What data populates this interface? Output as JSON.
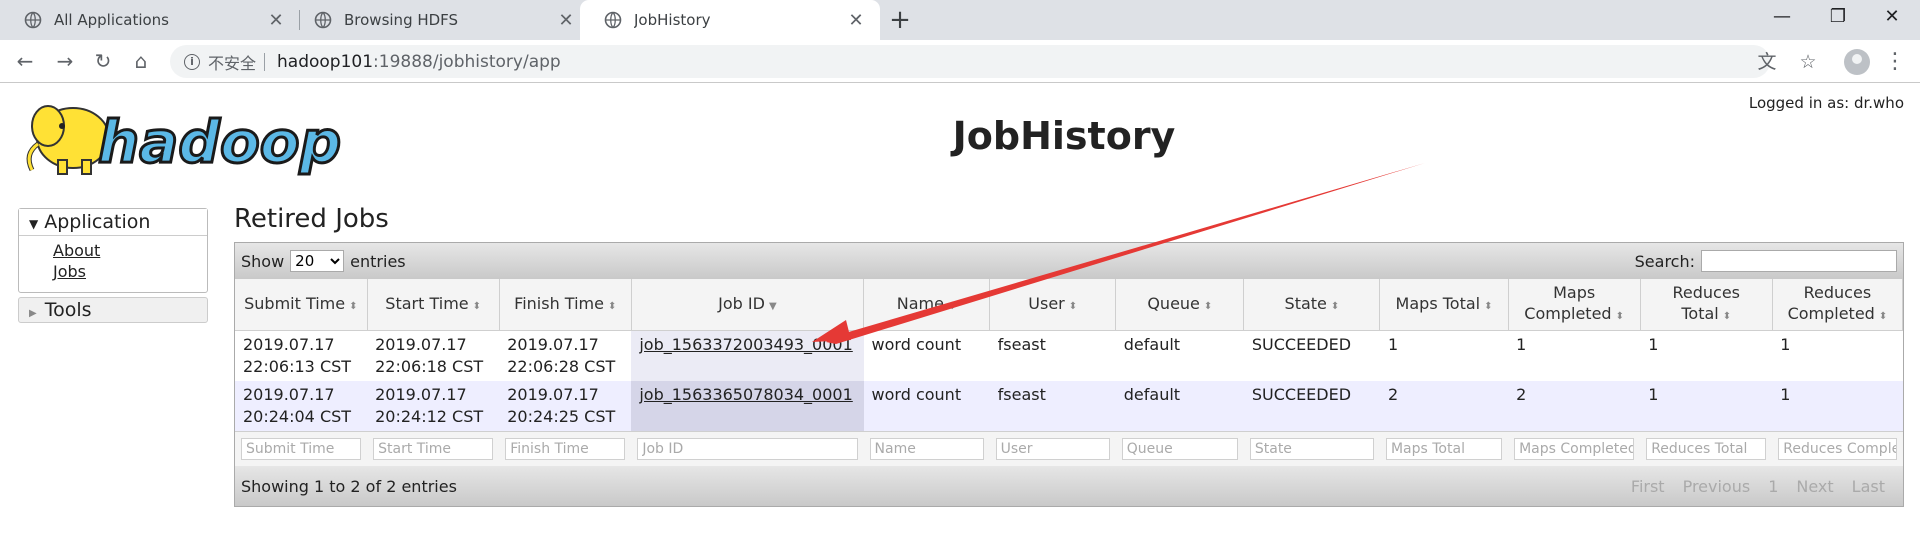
{
  "browser": {
    "tabs": [
      {
        "title": "All Applications",
        "active": false
      },
      {
        "title": "Browsing HDFS",
        "active": false
      },
      {
        "title": "JobHistory",
        "active": true
      }
    ],
    "insecure_label": "不安全",
    "url_host": "hadoop101",
    "url_rest": ":19888/jobhistory/app"
  },
  "page": {
    "logo_text": "hadoop",
    "logged_in": "Logged in as: dr.who",
    "title": "JobHistory"
  },
  "nav": {
    "application_label": "Application",
    "links": [
      "About",
      "Jobs"
    ],
    "tools_label": "Tools"
  },
  "jobs": {
    "section_title": "Retired Jobs",
    "show_label": "Show",
    "page_size": "20",
    "entries_label": "entries",
    "search_label": "Search:",
    "columns": [
      "Submit Time",
      "Start Time",
      "Finish Time",
      "Job ID",
      "Name",
      "User",
      "Queue",
      "State",
      "Maps Total",
      "Maps Completed",
      "Reduces Total",
      "Reduces Completed"
    ],
    "rows": [
      {
        "submit": "2019.07.17 22:06:13 CST",
        "start": "2019.07.17 22:06:18 CST",
        "finish": "2019.07.17 22:06:28 CST",
        "job_id": "job_1563372003493_0001",
        "name": "word count",
        "user": "fseast",
        "queue": "default",
        "state": "SUCCEEDED",
        "maps_total": "1",
        "maps_completed": "1",
        "reduces_total": "1",
        "reduces_completed": "1"
      },
      {
        "submit": "2019.07.17 20:24:04 CST",
        "start": "2019.07.17 20:24:12 CST",
        "finish": "2019.07.17 20:24:25 CST",
        "job_id": "job_1563365078034_0001",
        "name": "word count",
        "user": "fseast",
        "queue": "default",
        "state": "SUCCEEDED",
        "maps_total": "2",
        "maps_completed": "2",
        "reduces_total": "1",
        "reduces_completed": "1"
      }
    ],
    "filter_placeholders": [
      "Submit Time",
      "Start Time",
      "Finish Time",
      "Job ID",
      "Name",
      "User",
      "Queue",
      "State",
      "Maps Total",
      "Maps Completed",
      "Reduces Total",
      "Reduces Completed"
    ],
    "info": "Showing 1 to 2 of 2 entries",
    "pager": [
      "First",
      "Previous",
      "1",
      "Next",
      "Last"
    ]
  },
  "colors": {
    "annotation_arrow": "#e53935",
    "logo_yellow": "#ffe135",
    "logo_blue": "#5bb8e6"
  }
}
